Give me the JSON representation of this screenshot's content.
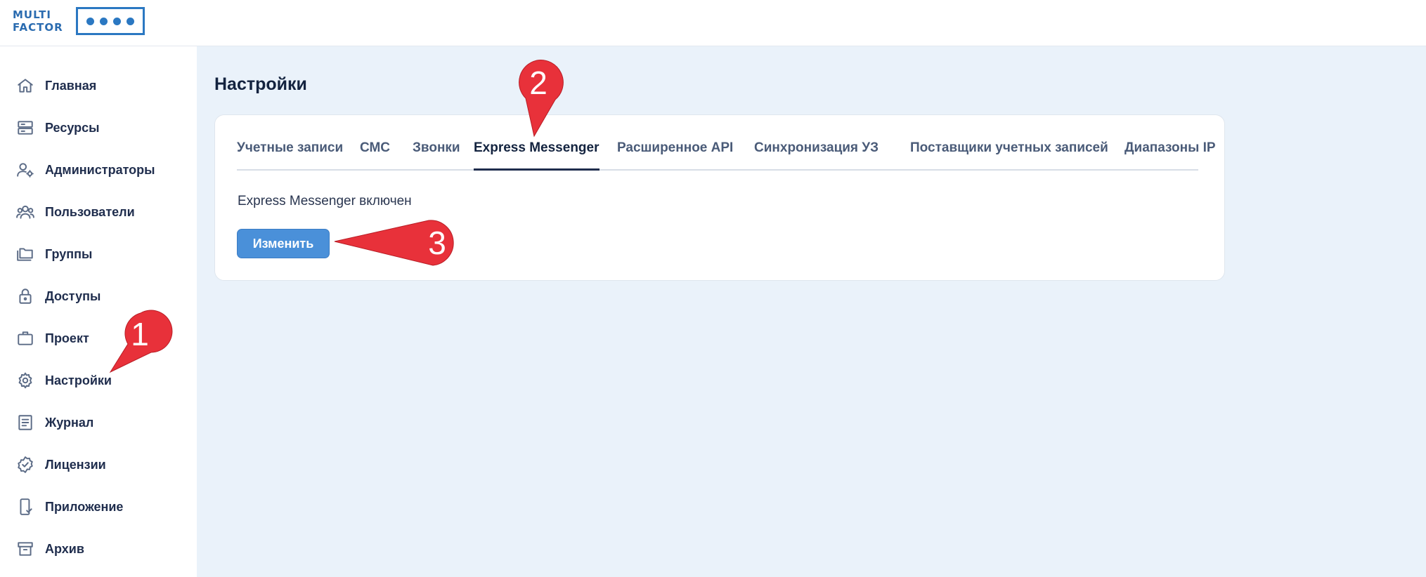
{
  "logo": {
    "line1": "MULTI",
    "line2": "FACTOR"
  },
  "sidebar": {
    "items": [
      {
        "label": "Главная",
        "icon": "home-icon"
      },
      {
        "label": "Ресурсы",
        "icon": "server-icon"
      },
      {
        "label": "Администраторы",
        "icon": "admin-user-gear-icon"
      },
      {
        "label": "Пользователи",
        "icon": "users-icon"
      },
      {
        "label": "Группы",
        "icon": "folders-icon"
      },
      {
        "label": "Доступы",
        "icon": "lock-icon"
      },
      {
        "label": "Проект",
        "icon": "briefcase-icon"
      },
      {
        "label": "Настройки",
        "icon": "gear-icon"
      },
      {
        "label": "Журнал",
        "icon": "journal-icon"
      },
      {
        "label": "Лицензии",
        "icon": "badge-check-icon"
      },
      {
        "label": "Приложение",
        "icon": "mobile-check-icon"
      },
      {
        "label": "Архив",
        "icon": "archive-icon"
      }
    ]
  },
  "main": {
    "title": "Настройки",
    "tabs": [
      {
        "label": "Учетные записи",
        "active": false
      },
      {
        "label": "СМС",
        "active": false
      },
      {
        "label": "Звонки",
        "active": false
      },
      {
        "label": "Express Messenger",
        "active": true
      },
      {
        "label": "Расширенное API",
        "active": false
      },
      {
        "label": "Синхронизация УЗ",
        "active": false
      },
      {
        "label": "Поставщики учетных записей",
        "active": false
      },
      {
        "label": "Диапазоны IP",
        "active": false
      }
    ],
    "status_text": "Express Messenger включен",
    "edit_button_label": "Изменить"
  },
  "annotations": {
    "marker1": "1",
    "marker2": "2",
    "marker3": "3",
    "color": "#e8313a"
  }
}
